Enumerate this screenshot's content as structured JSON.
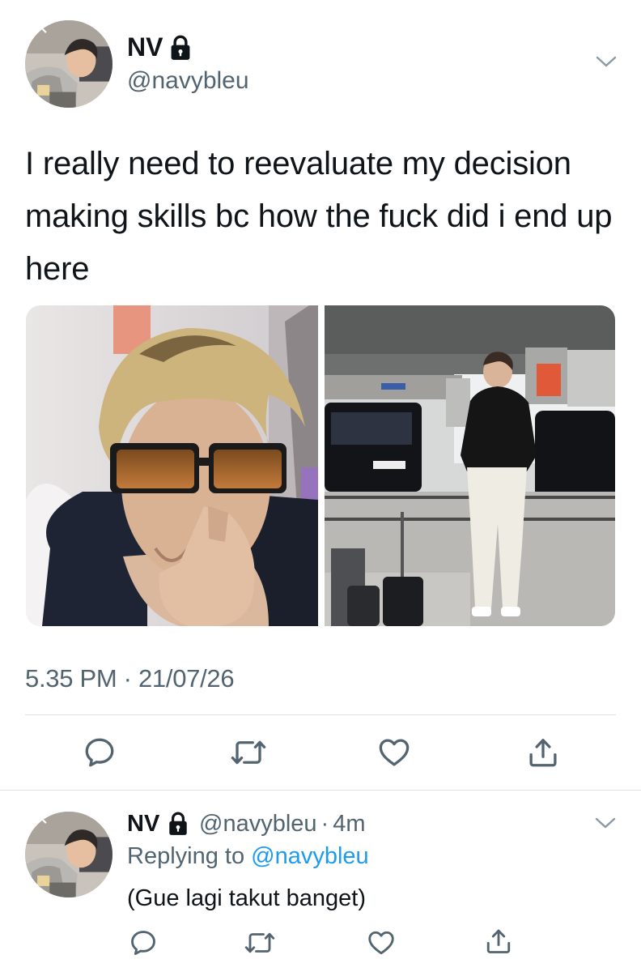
{
  "colors": {
    "text_primary": "#0f1419",
    "text_secondary": "#536471",
    "link": "#1d9bf0",
    "divider": "#dde1e4",
    "icon": "#536471"
  },
  "tweet": {
    "author": {
      "name": "NV",
      "handle": "@navybleu",
      "protected_icon": "lock-icon",
      "avatar_icon": "avatar"
    },
    "menu_icon": "chevron-down-icon",
    "text": "I really need to reevaluate my decision making skills bc how the fuck did i end up here",
    "media": [
      {
        "id": "photo-1",
        "kind": "selfie-photo"
      },
      {
        "id": "photo-2",
        "kind": "airport-photo"
      }
    ],
    "timestamp": "5.35 PM · 21/07/26",
    "actions": [
      {
        "name": "reply",
        "icon": "reply-icon"
      },
      {
        "name": "retweet",
        "icon": "retweet-icon"
      },
      {
        "name": "like",
        "icon": "heart-icon"
      },
      {
        "name": "share",
        "icon": "share-icon"
      }
    ]
  },
  "reply": {
    "author": {
      "name": "NV",
      "handle": "@navybleu",
      "separator": "·",
      "time": "4m",
      "protected_icon": "lock-icon"
    },
    "menu_icon": "chevron-down-icon",
    "replying_to_label": "Replying to",
    "replying_to_handle": "@navybleu",
    "text": "(Gue lagi takut banget)",
    "actions": [
      {
        "name": "reply",
        "icon": "reply-icon"
      },
      {
        "name": "retweet",
        "icon": "retweet-icon"
      },
      {
        "name": "like",
        "icon": "heart-icon"
      },
      {
        "name": "share",
        "icon": "share-icon"
      }
    ]
  }
}
